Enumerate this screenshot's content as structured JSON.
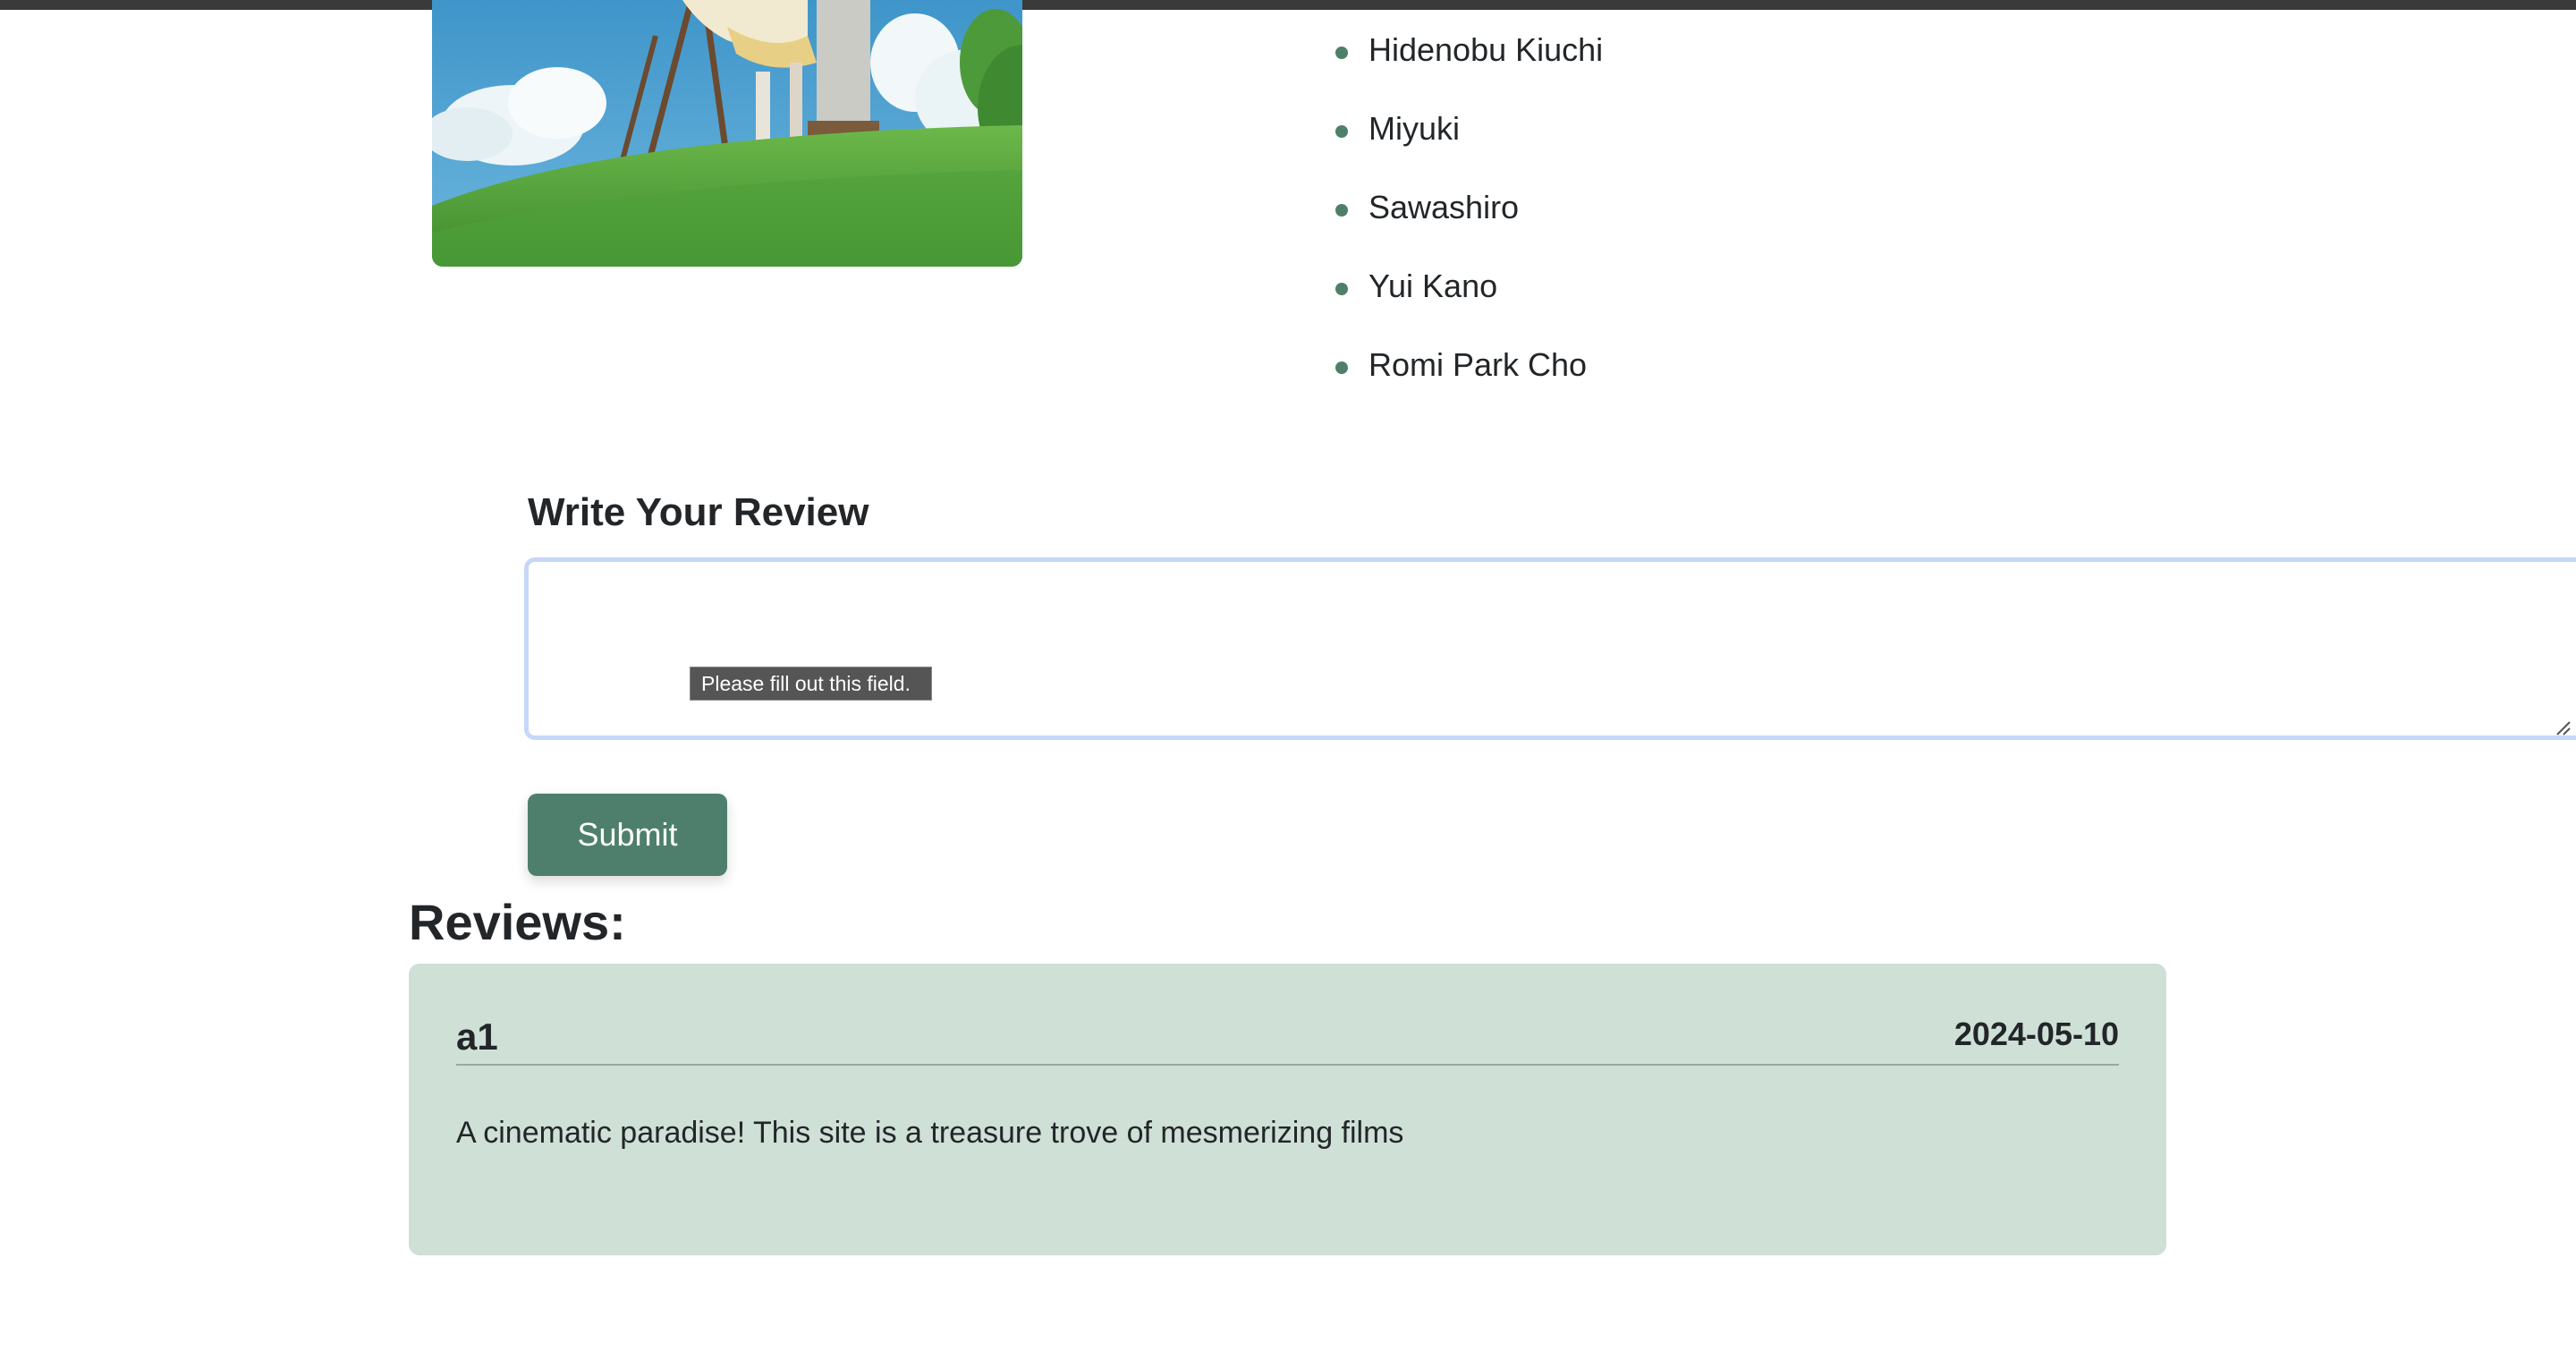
{
  "cast": {
    "members": [
      "Hidenobu Kiuchi",
      "Miyuki",
      "Sawashiro",
      "Yui Kano",
      "Romi Park Cho"
    ]
  },
  "review_form": {
    "heading": "Write Your Review",
    "textarea_value": "",
    "validation_tooltip": "Please fill out this field.",
    "submit_label": "Submit"
  },
  "reviews": {
    "title": "Reviews:",
    "items": [
      {
        "user": "a1",
        "date": "2024-05-10",
        "text": "A cinematic paradise! This site is a treasure trove of mesmerizing films"
      }
    ]
  },
  "colors": {
    "accent": "#4e7f6d",
    "review_card_bg": "#cfe0d6",
    "focus_ring": "#c6d7f7"
  }
}
